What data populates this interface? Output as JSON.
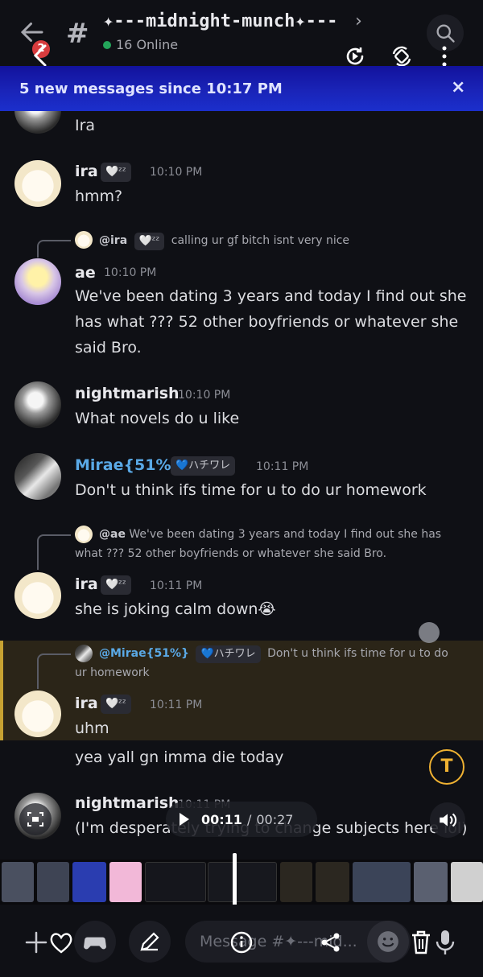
{
  "header": {
    "badge_count": "2",
    "hash_symbol": "#",
    "channel_name": "✦---midnight-munch✦---",
    "chevron": "›",
    "online_text": "16 Online"
  },
  "banner": {
    "text": "5 new messages since 10:17 PM",
    "close": "×"
  },
  "messages": [
    {
      "text": "Ira"
    },
    {
      "author": "ira",
      "tag": "🤍ᶻᶻ",
      "time": "10:10 PM",
      "text": "hmm?"
    },
    {
      "reply_name": "@ira",
      "reply_tag": "🤍ᶻᶻ",
      "reply_text": "calling ur gf bitch isnt very nice",
      "author": "ae",
      "time": "10:10 PM",
      "text": "We've been dating 3 years and today I find out she has what ??? 52 other boyfriends or whatever she said Bro."
    },
    {
      "author": "nightmarish",
      "time": "10:10 PM",
      "text": "What novels do u like"
    },
    {
      "author": "Mirae{51%}",
      "tag": "💙ハチワレ",
      "time": "10:11 PM",
      "text": "Don't u think ifs time for u to do ur homework"
    },
    {
      "reply_name": "@ae",
      "reply_text": "We've been dating 3 years and today I find out she has what ??? 52 other boyfriends or whatever she said Bro.",
      "author": "ira",
      "tag": "🤍ᶻᶻ",
      "time": "10:11 PM",
      "text": "she is joking calm down😭"
    },
    {
      "reply_name": "@Mirae{51%}",
      "reply_tag": "💙ハチワレ",
      "reply_text": "Don't u think ifs time for u to do ur homework",
      "author": "ira",
      "tag": "🤍ᶻᶻ",
      "time": "10:11 PM",
      "text": "uhm"
    },
    {
      "text": "yea yall gn imma die today"
    },
    {
      "author": "nightmarish",
      "time": "10:11 PM",
      "text": "(I'm desperately trying to change subjects here lol)"
    }
  ],
  "overlay": {
    "t_label": "T",
    "current_time": "00:11",
    "separator": "/",
    "duration": "00:27"
  },
  "composer": {
    "placeholder": "Message #✦---mid..."
  },
  "colors": {
    "banner": "#1a24b8",
    "highlight_bar": "#c7a232",
    "accent_blue": "#5aa9e6",
    "online": "#23a55a"
  }
}
